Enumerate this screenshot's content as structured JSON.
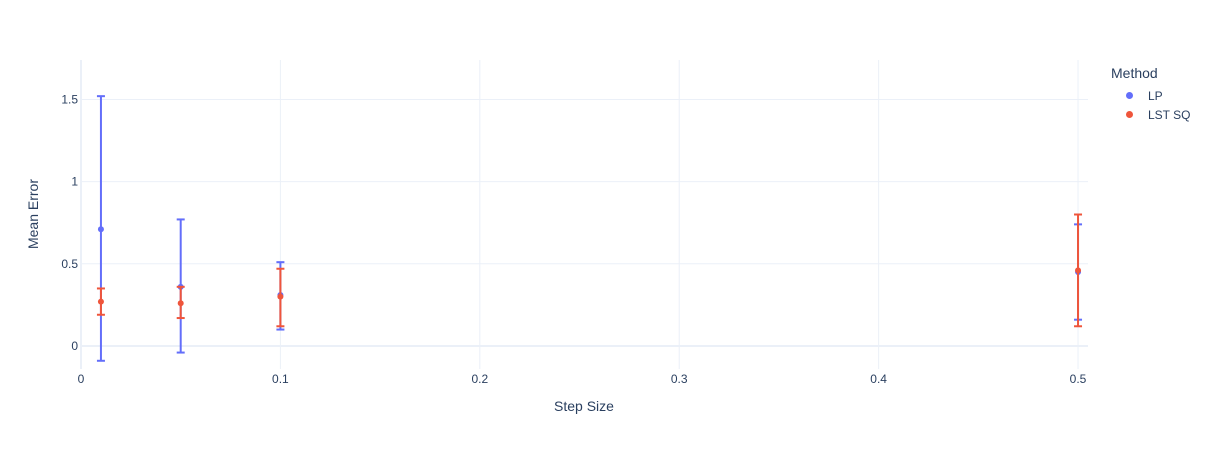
{
  "legend": {
    "title": "Method"
  },
  "chart_data": {
    "type": "scatter",
    "xlabel": "Step Size",
    "ylabel": "Mean Error",
    "xlim": [
      0,
      0.505
    ],
    "ylim": [
      -0.14,
      1.74
    ],
    "x_ticks": [
      "0",
      "0.1",
      "0.2",
      "0.3",
      "0.4",
      "0.5"
    ],
    "y_ticks": [
      "0",
      "0.5",
      "1",
      "1.5"
    ],
    "grid": true,
    "legend_position": "top-right",
    "series": [
      {
        "name": "LP",
        "color": "#636efa",
        "points": [
          {
            "x": 0.01,
            "y": 0.71,
            "err_low": -0.09,
            "err_high": 1.52
          },
          {
            "x": 0.05,
            "y": 0.36,
            "err_low": -0.04,
            "err_high": 0.77
          },
          {
            "x": 0.1,
            "y": 0.31,
            "err_low": 0.1,
            "err_high": 0.51
          },
          {
            "x": 0.5,
            "y": 0.45,
            "err_low": 0.16,
            "err_high": 0.74
          }
        ]
      },
      {
        "name": "LST SQ",
        "color": "#ef553b",
        "points": [
          {
            "x": 0.01,
            "y": 0.27,
            "err_low": 0.19,
            "err_high": 0.35
          },
          {
            "x": 0.05,
            "y": 0.26,
            "err_low": 0.17,
            "err_high": 0.36
          },
          {
            "x": 0.1,
            "y": 0.3,
            "err_low": 0.12,
            "err_high": 0.47
          },
          {
            "x": 0.5,
            "y": 0.46,
            "err_low": 0.12,
            "err_high": 0.8
          }
        ]
      }
    ]
  }
}
